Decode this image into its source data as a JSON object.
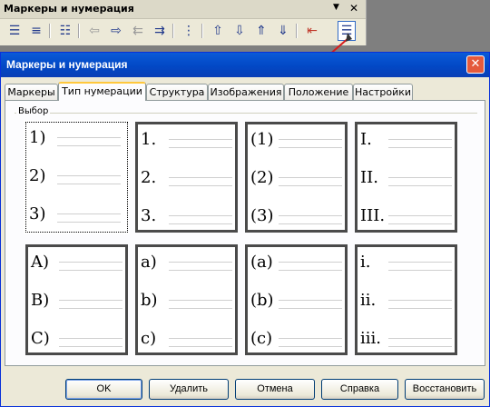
{
  "toolbar": {
    "title": "Маркеры и нумерация",
    "icons": [
      "bullets-on-off-icon",
      "numbering-on-off-icon",
      "outline-icon",
      "promote-level-icon",
      "demote-level-icon",
      "promote-with-subpoints-icon",
      "demote-with-subpoints-icon",
      "insert-unnumbered-entry-icon",
      "move-up-icon",
      "move-down-icon",
      "move-up-with-subpoints-icon",
      "move-down-with-subpoints-icon",
      "restart-numbering-icon",
      "bullets-numbering-dialog-icon"
    ]
  },
  "dialog": {
    "title": "Маркеры и нумерация",
    "tabs": [
      "Маркеры",
      "Тип нумерации",
      "Структура",
      "Изображения",
      "Положение",
      "Настройки"
    ],
    "active_tab": "Тип нумерации",
    "group_label": "Выбор",
    "presets": [
      {
        "items": [
          "1)",
          "2)",
          "3)"
        ]
      },
      {
        "items": [
          "1.",
          "2.",
          "3."
        ]
      },
      {
        "items": [
          "(1)",
          "(2)",
          "(3)"
        ]
      },
      {
        "items": [
          "I.",
          "II.",
          "III."
        ]
      },
      {
        "items": [
          "A)",
          "B)",
          "C)"
        ]
      },
      {
        "items": [
          "a)",
          "b)",
          "c)"
        ]
      },
      {
        "items": [
          "(a)",
          "(b)",
          "(c)"
        ]
      },
      {
        "items": [
          "i.",
          "ii.",
          "iii."
        ]
      }
    ],
    "buttons": {
      "ok": "OK",
      "delete": "Удалить",
      "cancel": "Отмена",
      "help": "Справка",
      "restore": "Восстановить"
    }
  },
  "colors": {
    "titlebar": "#0248c5",
    "window_bg": "#ece9d8",
    "pointer": "#d71c1c"
  }
}
